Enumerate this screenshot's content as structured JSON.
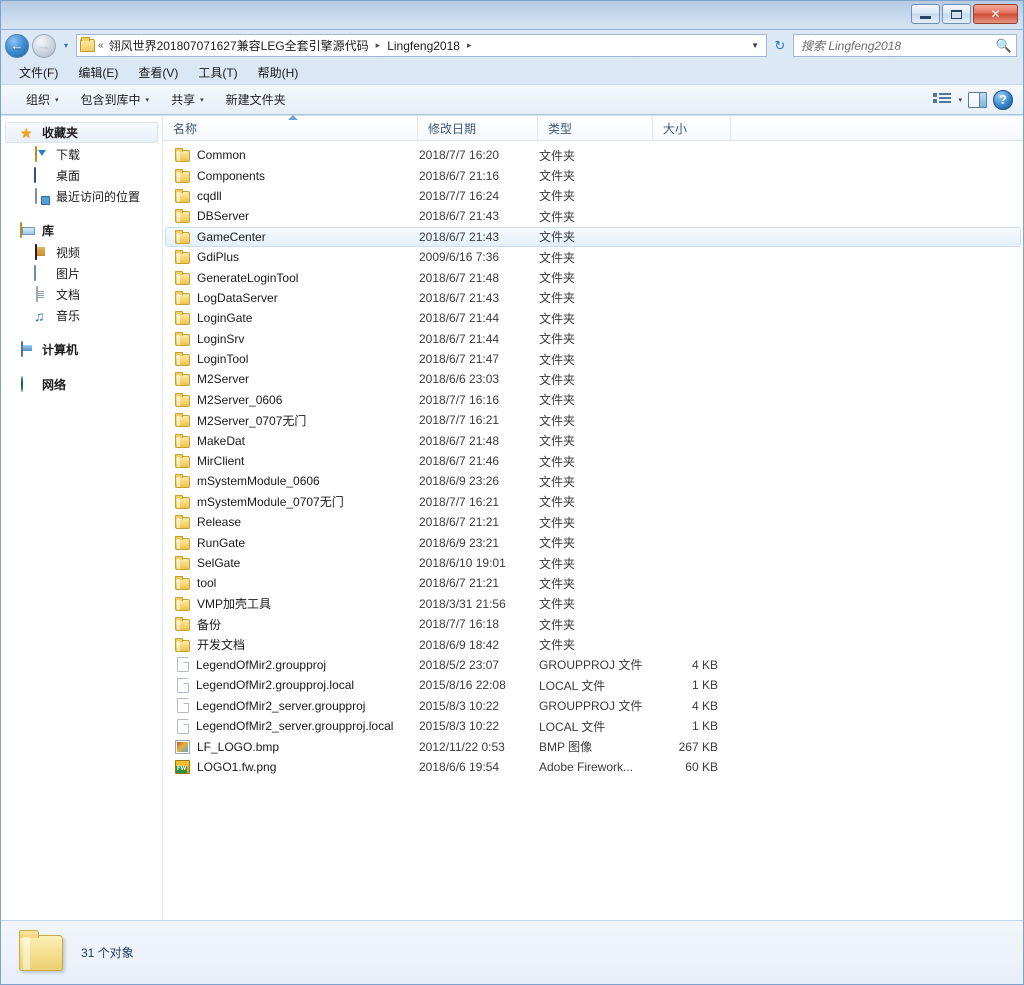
{
  "window": {
    "controls": {
      "minimize": "minimize",
      "maximize": "maximize",
      "close": "✕"
    }
  },
  "address": {
    "folder_icon": "folder-icon",
    "overflow_chevron": "«",
    "crumbs": [
      {
        "label": "翎风世界201807071627兼容LEG全套引擎源代码"
      },
      {
        "label": "Lingfeng2018"
      }
    ],
    "separator": "▸",
    "dropdown_caret": "▼",
    "refresh": "↻",
    "back_glyph": "←",
    "forward_glyph": "→",
    "history_caret": "▾"
  },
  "search": {
    "placeholder": "搜索 Lingfeng2018",
    "value": "",
    "icon": "search-icon"
  },
  "menubar": {
    "items": [
      {
        "label": "文件(F)"
      },
      {
        "label": "编辑(E)"
      },
      {
        "label": "查看(V)"
      },
      {
        "label": "工具(T)"
      },
      {
        "label": "帮助(H)"
      }
    ]
  },
  "toolbar": {
    "organize": "组织",
    "include_in_library": "包含到库中",
    "share": "共享",
    "new_folder": "新建文件夹",
    "caret": "▾",
    "help_label": "?"
  },
  "sidebar": {
    "groups": [
      {
        "header": {
          "label": "收藏夹",
          "icon": "star-icon",
          "selected": true
        },
        "children": [
          {
            "label": "下载",
            "icon": "download-icon"
          },
          {
            "label": "桌面",
            "icon": "desktop-icon"
          },
          {
            "label": "最近访问的位置",
            "icon": "recent-places-icon"
          }
        ]
      },
      {
        "header": {
          "label": "库",
          "icon": "library-icon",
          "selected": false
        },
        "children": [
          {
            "label": "视频",
            "icon": "video-icon"
          },
          {
            "label": "图片",
            "icon": "pictures-icon"
          },
          {
            "label": "文档",
            "icon": "documents-icon"
          },
          {
            "label": "音乐",
            "icon": "music-icon"
          }
        ]
      },
      {
        "header": {
          "label": "计算机",
          "icon": "computer-icon",
          "selected": false
        },
        "children": []
      },
      {
        "header": {
          "label": "网络",
          "icon": "network-icon",
          "selected": false
        },
        "children": []
      }
    ]
  },
  "filelist": {
    "columns": [
      {
        "key": "name",
        "label": "名称",
        "sorted": "asc"
      },
      {
        "key": "date",
        "label": "修改日期"
      },
      {
        "key": "type",
        "label": "类型"
      },
      {
        "key": "size",
        "label": "大小"
      }
    ],
    "rows": [
      {
        "name": "Common",
        "date": "2018/7/7 16:20",
        "type": "文件夹",
        "size": "",
        "icon": "folder",
        "selected": false
      },
      {
        "name": "Components",
        "date": "2018/6/7 21:16",
        "type": "文件夹",
        "size": "",
        "icon": "folder",
        "selected": false
      },
      {
        "name": "cqdll",
        "date": "2018/7/7 16:24",
        "type": "文件夹",
        "size": "",
        "icon": "folder",
        "selected": false
      },
      {
        "name": "DBServer",
        "date": "2018/6/7 21:43",
        "type": "文件夹",
        "size": "",
        "icon": "folder",
        "selected": false
      },
      {
        "name": "GameCenter",
        "date": "2018/6/7 21:43",
        "type": "文件夹",
        "size": "",
        "icon": "folder",
        "selected": true
      },
      {
        "name": "GdiPlus",
        "date": "2009/6/16 7:36",
        "type": "文件夹",
        "size": "",
        "icon": "folder",
        "selected": false
      },
      {
        "name": "GenerateLoginTool",
        "date": "2018/6/7 21:48",
        "type": "文件夹",
        "size": "",
        "icon": "folder",
        "selected": false
      },
      {
        "name": "LogDataServer",
        "date": "2018/6/7 21:43",
        "type": "文件夹",
        "size": "",
        "icon": "folder",
        "selected": false
      },
      {
        "name": "LoginGate",
        "date": "2018/6/7 21:44",
        "type": "文件夹",
        "size": "",
        "icon": "folder",
        "selected": false
      },
      {
        "name": "LoginSrv",
        "date": "2018/6/7 21:44",
        "type": "文件夹",
        "size": "",
        "icon": "folder",
        "selected": false
      },
      {
        "name": "LoginTool",
        "date": "2018/6/7 21:47",
        "type": "文件夹",
        "size": "",
        "icon": "folder",
        "selected": false
      },
      {
        "name": "M2Server",
        "date": "2018/6/6 23:03",
        "type": "文件夹",
        "size": "",
        "icon": "folder",
        "selected": false
      },
      {
        "name": "M2Server_0606",
        "date": "2018/7/7 16:16",
        "type": "文件夹",
        "size": "",
        "icon": "folder",
        "selected": false
      },
      {
        "name": "M2Server_0707无门",
        "date": "2018/7/7 16:21",
        "type": "文件夹",
        "size": "",
        "icon": "folder",
        "selected": false
      },
      {
        "name": "MakeDat",
        "date": "2018/6/7 21:48",
        "type": "文件夹",
        "size": "",
        "icon": "folder",
        "selected": false
      },
      {
        "name": "MirClient",
        "date": "2018/6/7 21:46",
        "type": "文件夹",
        "size": "",
        "icon": "folder",
        "selected": false
      },
      {
        "name": "mSystemModule_0606",
        "date": "2018/6/9 23:26",
        "type": "文件夹",
        "size": "",
        "icon": "folder",
        "selected": false
      },
      {
        "name": "mSystemModule_0707无门",
        "date": "2018/7/7 16:21",
        "type": "文件夹",
        "size": "",
        "icon": "folder",
        "selected": false
      },
      {
        "name": "Release",
        "date": "2018/6/7 21:21",
        "type": "文件夹",
        "size": "",
        "icon": "folder",
        "selected": false
      },
      {
        "name": "RunGate",
        "date": "2018/6/9 23:21",
        "type": "文件夹",
        "size": "",
        "icon": "folder",
        "selected": false
      },
      {
        "name": "SelGate",
        "date": "2018/6/10 19:01",
        "type": "文件夹",
        "size": "",
        "icon": "folder",
        "selected": false
      },
      {
        "name": "tool",
        "date": "2018/6/7 21:21",
        "type": "文件夹",
        "size": "",
        "icon": "folder",
        "selected": false
      },
      {
        "name": "VMP加壳工具",
        "date": "2018/3/31 21:56",
        "type": "文件夹",
        "size": "",
        "icon": "folder",
        "selected": false
      },
      {
        "name": "备份",
        "date": "2018/7/7 16:18",
        "type": "文件夹",
        "size": "",
        "icon": "folder",
        "selected": false
      },
      {
        "name": "开发文档",
        "date": "2018/6/9 18:42",
        "type": "文件夹",
        "size": "",
        "icon": "folder",
        "selected": false
      },
      {
        "name": "LegendOfMir2.groupproj",
        "date": "2018/5/2 23:07",
        "type": "GROUPPROJ 文件",
        "size": "4 KB",
        "icon": "file",
        "selected": false
      },
      {
        "name": "LegendOfMir2.groupproj.local",
        "date": "2015/8/16 22:08",
        "type": "LOCAL 文件",
        "size": "1 KB",
        "icon": "file",
        "selected": false
      },
      {
        "name": "LegendOfMir2_server.groupproj",
        "date": "2015/8/3 10:22",
        "type": "GROUPPROJ 文件",
        "size": "4 KB",
        "icon": "file",
        "selected": false
      },
      {
        "name": "LegendOfMir2_server.groupproj.local",
        "date": "2015/8/3 10:22",
        "type": "LOCAL 文件",
        "size": "1 KB",
        "icon": "file",
        "selected": false
      },
      {
        "name": "LF_LOGO.bmp",
        "date": "2012/11/22 0:53",
        "type": "BMP 图像",
        "size": "267 KB",
        "icon": "bmp",
        "selected": false
      },
      {
        "name": "LOGO1.fw.png",
        "date": "2018/6/6 19:54",
        "type": "Adobe Firework...",
        "size": "60 KB",
        "icon": "fw",
        "selected": false
      }
    ]
  },
  "statusbar": {
    "item_count_text": "31 个对象",
    "folder_icon": "folder-icon"
  }
}
